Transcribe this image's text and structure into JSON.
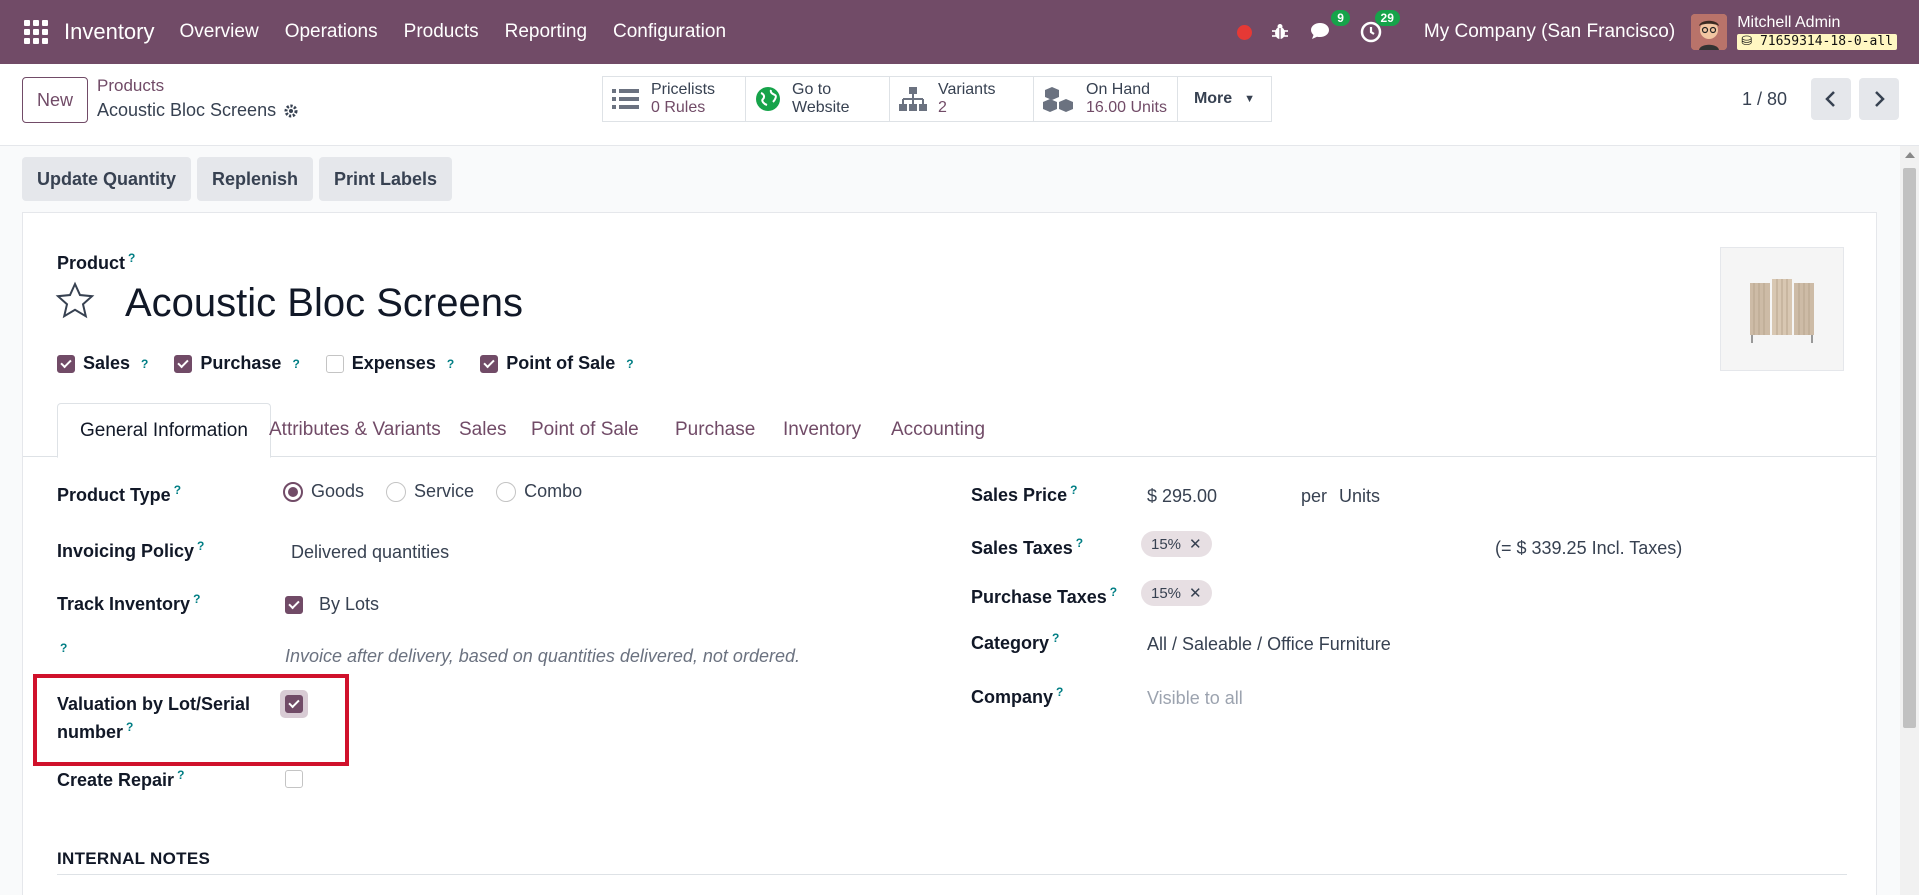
{
  "navbar": {
    "app_name": "Inventory",
    "menu": [
      "Overview",
      "Operations",
      "Products",
      "Reporting",
      "Configuration"
    ],
    "messages_badge": "9",
    "activities_badge": "29",
    "company": "My Company (San Francisco)",
    "user_name": "Mitchell Admin",
    "db_name": "71659314-18-0-all"
  },
  "control": {
    "new_label": "New",
    "breadcrumb_parent": "Products",
    "breadcrumb_current": "Acoustic Bloc Screens",
    "smart_buttons": [
      {
        "label": "Pricelists",
        "value": "0 Rules",
        "icon": "list-icon"
      },
      {
        "label": "Go to",
        "value": "Website",
        "icon": "globe-icon"
      },
      {
        "label": "Variants",
        "value": "2",
        "icon": "sitemap-icon"
      },
      {
        "label": "On Hand",
        "value": "16.00 Units",
        "icon": "cubes-icon"
      }
    ],
    "more_label": "More",
    "pager": "1 / 80"
  },
  "actions": [
    "Update Quantity",
    "Replenish",
    "Print Labels"
  ],
  "product": {
    "label": "Product",
    "name": "Acoustic Bloc Screens",
    "checks": [
      {
        "label": "Sales",
        "checked": true
      },
      {
        "label": "Purchase",
        "checked": true
      },
      {
        "label": "Expenses",
        "checked": false
      },
      {
        "label": "Point of Sale",
        "checked": true
      }
    ]
  },
  "tabs": [
    "General Information",
    "Attributes & Variants",
    "Sales",
    "Point of Sale",
    "Purchase",
    "Inventory",
    "Accounting"
  ],
  "form": {
    "product_type_label": "Product Type",
    "product_type_options": [
      "Goods",
      "Service",
      "Combo"
    ],
    "product_type_selected": "Goods",
    "invoicing_policy_label": "Invoicing Policy",
    "invoicing_policy_value": "Delivered quantities",
    "track_inventory_label": "Track Inventory",
    "track_inventory_value": "By Lots",
    "helper_text": "Invoice after delivery, based on quantities delivered, not ordered.",
    "valuation_label_line1": "Valuation by Lot/Serial",
    "valuation_label_line2": "number",
    "create_repair_label": "Create Repair",
    "sales_price_label": "Sales Price",
    "sales_price_value": "$ 295.00",
    "sales_price_per": "per",
    "sales_price_unit": "Units",
    "sales_taxes_label": "Sales Taxes",
    "sales_taxes_tag": "15%",
    "sales_taxes_incl": "(= $ 339.25 Incl. Taxes)",
    "purchase_taxes_label": "Purchase Taxes",
    "purchase_taxes_tag": "15%",
    "category_label": "Category",
    "category_value": "All / Saleable / Office Furniture",
    "company_label": "Company",
    "company_placeholder": "Visible to all",
    "internal_notes_title": "INTERNAL NOTES"
  },
  "colors": {
    "brand": "#714b67",
    "highlight": "#d0112b",
    "badge": "#16a34a"
  }
}
